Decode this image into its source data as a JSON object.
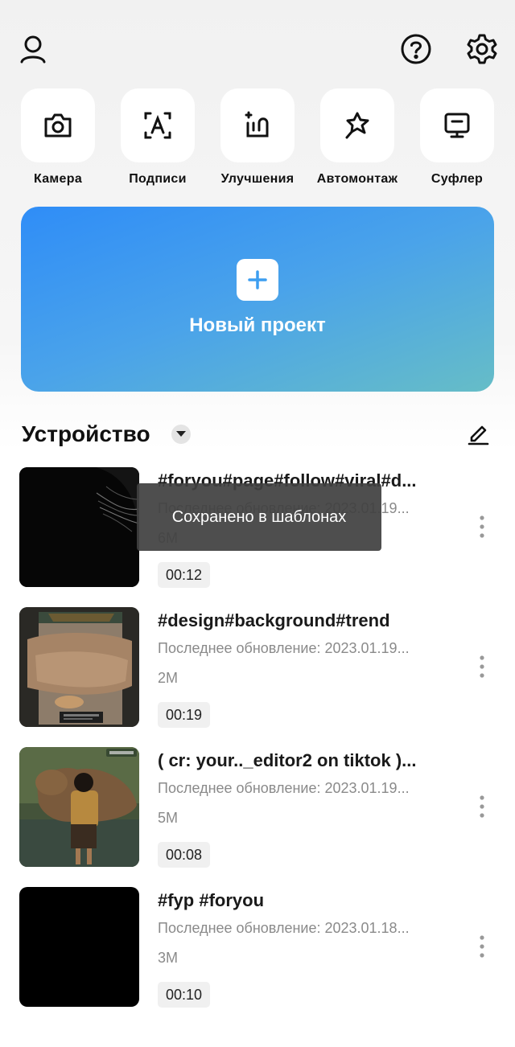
{
  "topbar": {
    "profile_icon": "user-icon",
    "help_icon": "help-circle-icon",
    "settings_icon": "gear-icon"
  },
  "tools": [
    {
      "label": "Камера",
      "icon": "camera-icon"
    },
    {
      "label": "Подписи",
      "icon": "auto-captions-icon"
    },
    {
      "label": "Улучшения",
      "icon": "enhance-icon"
    },
    {
      "label": "Автомонтаж",
      "icon": "autocut-star-icon"
    },
    {
      "label": "Суфлер",
      "icon": "teleprompter-icon"
    }
  ],
  "new_project": {
    "label": "Новый проект",
    "icon": "plus-icon",
    "gradient": [
      "#2f8df7",
      "#66bdc7"
    ]
  },
  "section": {
    "title": "Устройство",
    "dropdown_icon": "caret-down-icon",
    "edit_icon": "edit-icon"
  },
  "projects": [
    {
      "title": "#foryou#page#follow#viral#d...",
      "updated": "Последнее обновление: 2023.01.19...",
      "size": "6M",
      "duration": "00:12",
      "thumb": "dark-cat-whiskers"
    },
    {
      "title": "#design#background#trend",
      "updated": "Последнее обновление: 2023.01.19...",
      "size": "2M",
      "duration": "00:19",
      "thumb": "capybara-frame"
    },
    {
      "title": "( cr: your.._editor2 on tiktok )...",
      "updated": "Последнее обновление: 2023.01.19...",
      "size": "5M",
      "duration": "00:08",
      "thumb": "capybara-boy"
    },
    {
      "title": "#fyp #foryou",
      "updated": "Последнее обновление: 2023.01.18...",
      "size": "3M",
      "duration": "00:10",
      "thumb": "black"
    }
  ],
  "toast": {
    "message": "Сохранено в шаблонах"
  }
}
